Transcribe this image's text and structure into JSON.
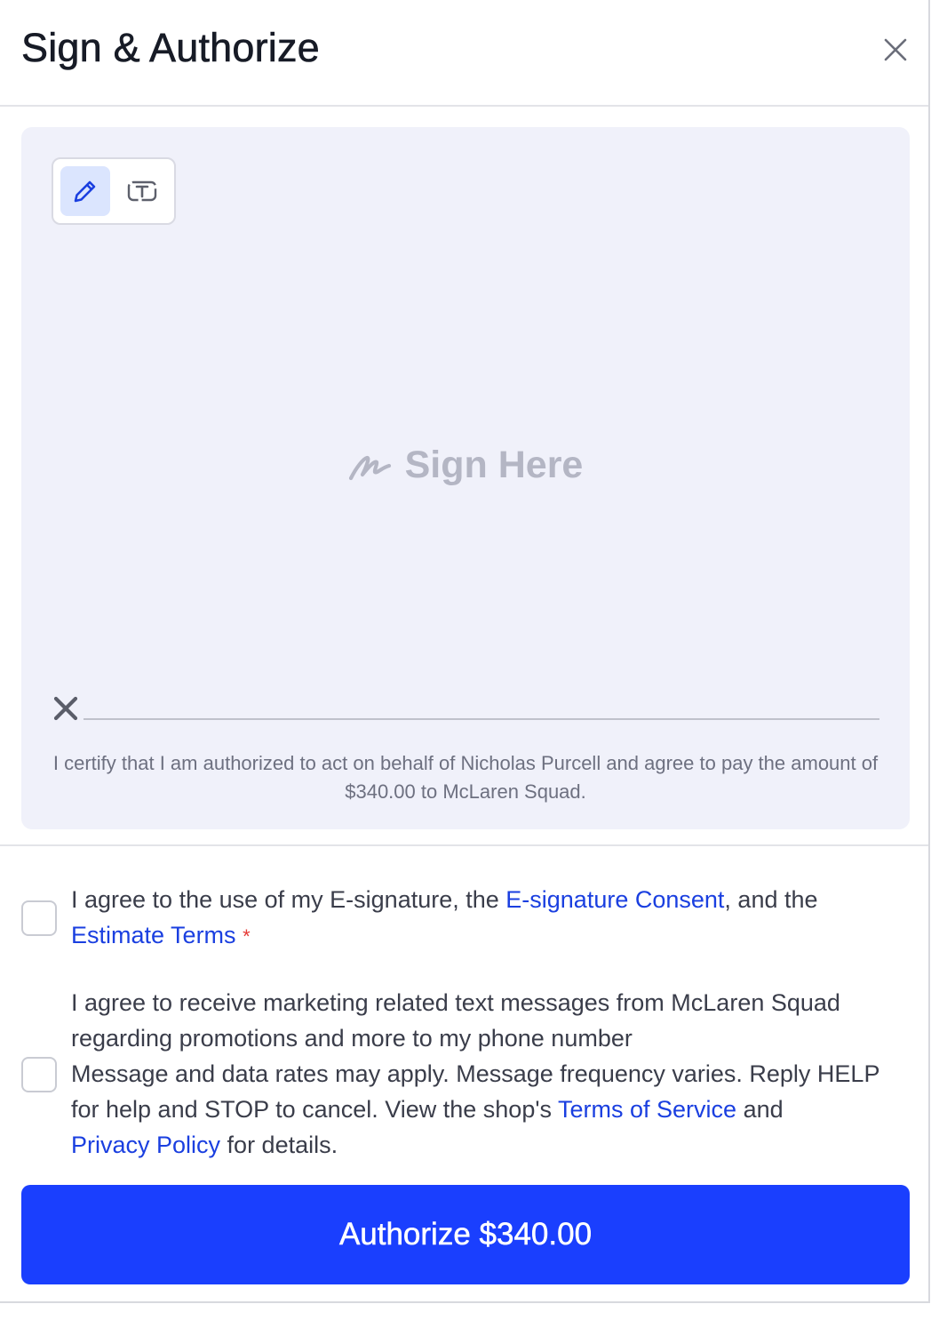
{
  "header": {
    "title": "Sign & Authorize"
  },
  "sign_area": {
    "modes": [
      {
        "name": "draw",
        "icon": "pencil-icon",
        "active": true
      },
      {
        "name": "type",
        "icon": "text-box-icon",
        "active": false
      }
    ],
    "placeholder": "Sign Here",
    "certify_text": "I certify that I am authorized to act on behalf of Nicholas Purcell and agree to pay the amount of $340.00 to McLaren Squad."
  },
  "consent": {
    "esign": {
      "prefix": "I agree to the use of my E-signature, the ",
      "link1": "E-signature Consent",
      "middle": ", and the ",
      "link2": "Estimate Terms",
      "required_mark": "*",
      "checked": false
    },
    "marketing": {
      "line1": "I agree to receive marketing related text messages from McLaren Squad regarding promotions and more to my phone number",
      "line2_prefix": "Message and data rates may apply. Message frequency varies. Reply HELP for help and STOP to cancel. View the shop's ",
      "link_tos": "Terms of Service",
      "and": " and ",
      "link_privacy": "Privacy Policy",
      "suffix": " for details.",
      "checked": false
    }
  },
  "authorize_button": {
    "label": "Authorize $340.00"
  },
  "colors": {
    "primary": "#1a3ffe",
    "link": "#1a3fe0",
    "sign_bg": "#f0f1fa",
    "required": "#e53935"
  }
}
